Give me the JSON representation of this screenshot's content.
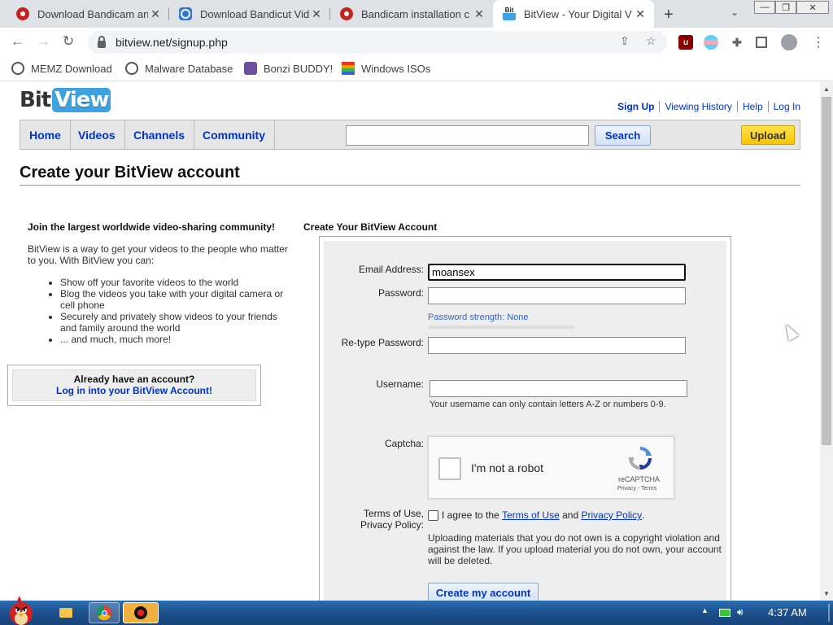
{
  "browser": {
    "tabs": [
      {
        "title": "Download Bandicam an",
        "icon": "bandicam-icon"
      },
      {
        "title": "Download Bandicut Vid",
        "icon": "bandicut-icon"
      },
      {
        "title": "Bandicam installation c",
        "icon": "bandicam-icon"
      },
      {
        "title": "BitView - Your Digital V",
        "icon": "bitview-icon"
      }
    ],
    "url": "bitview.net/signup.php",
    "bookmarks": [
      {
        "label": "MEMZ Download",
        "icon": "globe-icon"
      },
      {
        "label": "Malware Database",
        "icon": "globe-icon"
      },
      {
        "label": "Bonzi BUDDY!",
        "icon": "bonzi-icon"
      },
      {
        "label": "Windows ISOs",
        "icon": "windows-flag-icon"
      }
    ],
    "tab_fav_text": "Bit"
  },
  "site": {
    "logo": {
      "part1": "Bit",
      "part2": "View"
    },
    "toplinks": {
      "signup": "Sign Up",
      "history": "Viewing History",
      "help": "Help",
      "login": "Log In"
    },
    "nav": {
      "home": "Home",
      "videos": "Videos",
      "channels": "Channels",
      "community": "Community",
      "search_btn": "Search",
      "search_value": "",
      "upload": "Upload"
    },
    "page_title": "Create your BitView account"
  },
  "left": {
    "heading": "Join the largest worldwide video-sharing community!",
    "intro": "BitView is a way to get your videos to the people who matter to you. With BitView you can:",
    "bullets": [
      "Show off your favorite videos to the world",
      "Blog the videos you take with your digital camera or cell phone",
      "Securely and privately show videos to your friends and family around the world",
      "... and much, much more!"
    ],
    "already_q": "Already have an account?",
    "already_link": "Log in into your BitView Account!"
  },
  "form": {
    "title": "Create Your BitView Account",
    "email_label": "Email Address:",
    "email_value": "moansex",
    "password_label": "Password:",
    "password_strength": "Password strength: None",
    "retype_label": "Re-type Password:",
    "username_label": "Username:",
    "username_hint": "Your username can only contain letters A-Z or numbers 0-9.",
    "captcha_label": "Captcha:",
    "captcha_text": "I'm not a robot",
    "captcha_brand": "reCAPTCHA",
    "captcha_links": "Privacy - Terms",
    "terms_label_1": "Terms of Use,",
    "terms_label_2": "Privacy Policy:",
    "agree_prefix": "I agree to the",
    "terms_link": "Terms of Use",
    "and": "and",
    "privacy_link": "Privacy Policy",
    "legal": "Uploading materials that you do not own is a copyright violation and against the law. If you upload material you do not own, your account will be deleted.",
    "submit": "Create my account"
  },
  "taskbar": {
    "clock": "4:37 AM"
  },
  "colors": {
    "link": "#0033cc",
    "logo_blue": "#3fa2e0",
    "upload_yellow": "#f6c500",
    "taskbar": "#1d4f8b"
  }
}
